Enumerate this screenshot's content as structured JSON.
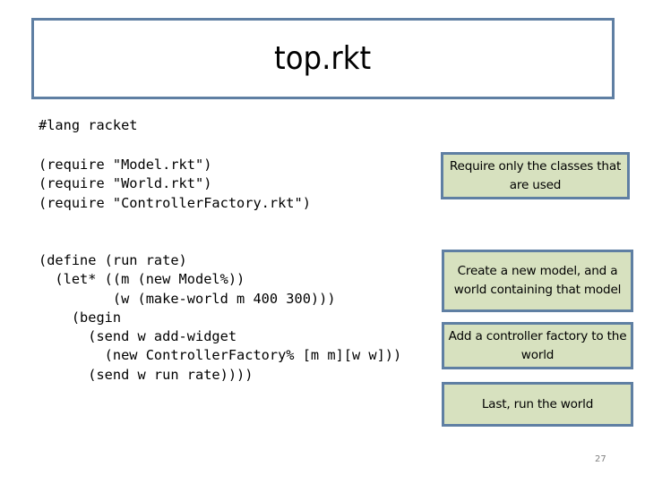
{
  "slide": {
    "title": "top.rkt",
    "page_number": "27",
    "colors": {
      "box_border": "#5f7fa3",
      "note_fill": "#d7e1bf",
      "background": "#ffffff"
    }
  },
  "code": {
    "lang_line": "#lang racket",
    "requires": [
      "(require \"Model.rkt\")",
      "(require \"World.rkt\")",
      "(require \"ControllerFactory.rkt\")"
    ],
    "body": [
      "(define (run rate)",
      "  (let* ((m (new Model%))",
      "         (w (make-world m 400 300)))",
      "    (begin",
      "      (send w add-widget",
      "        (new ControllerFactory% [m m][w w]))",
      "      (send w run rate))))"
    ]
  },
  "notes": [
    "Require only the classes that are used",
    "Create a new model, and a world containing that model",
    "Add a controller factory to the world",
    "Last, run the world"
  ]
}
